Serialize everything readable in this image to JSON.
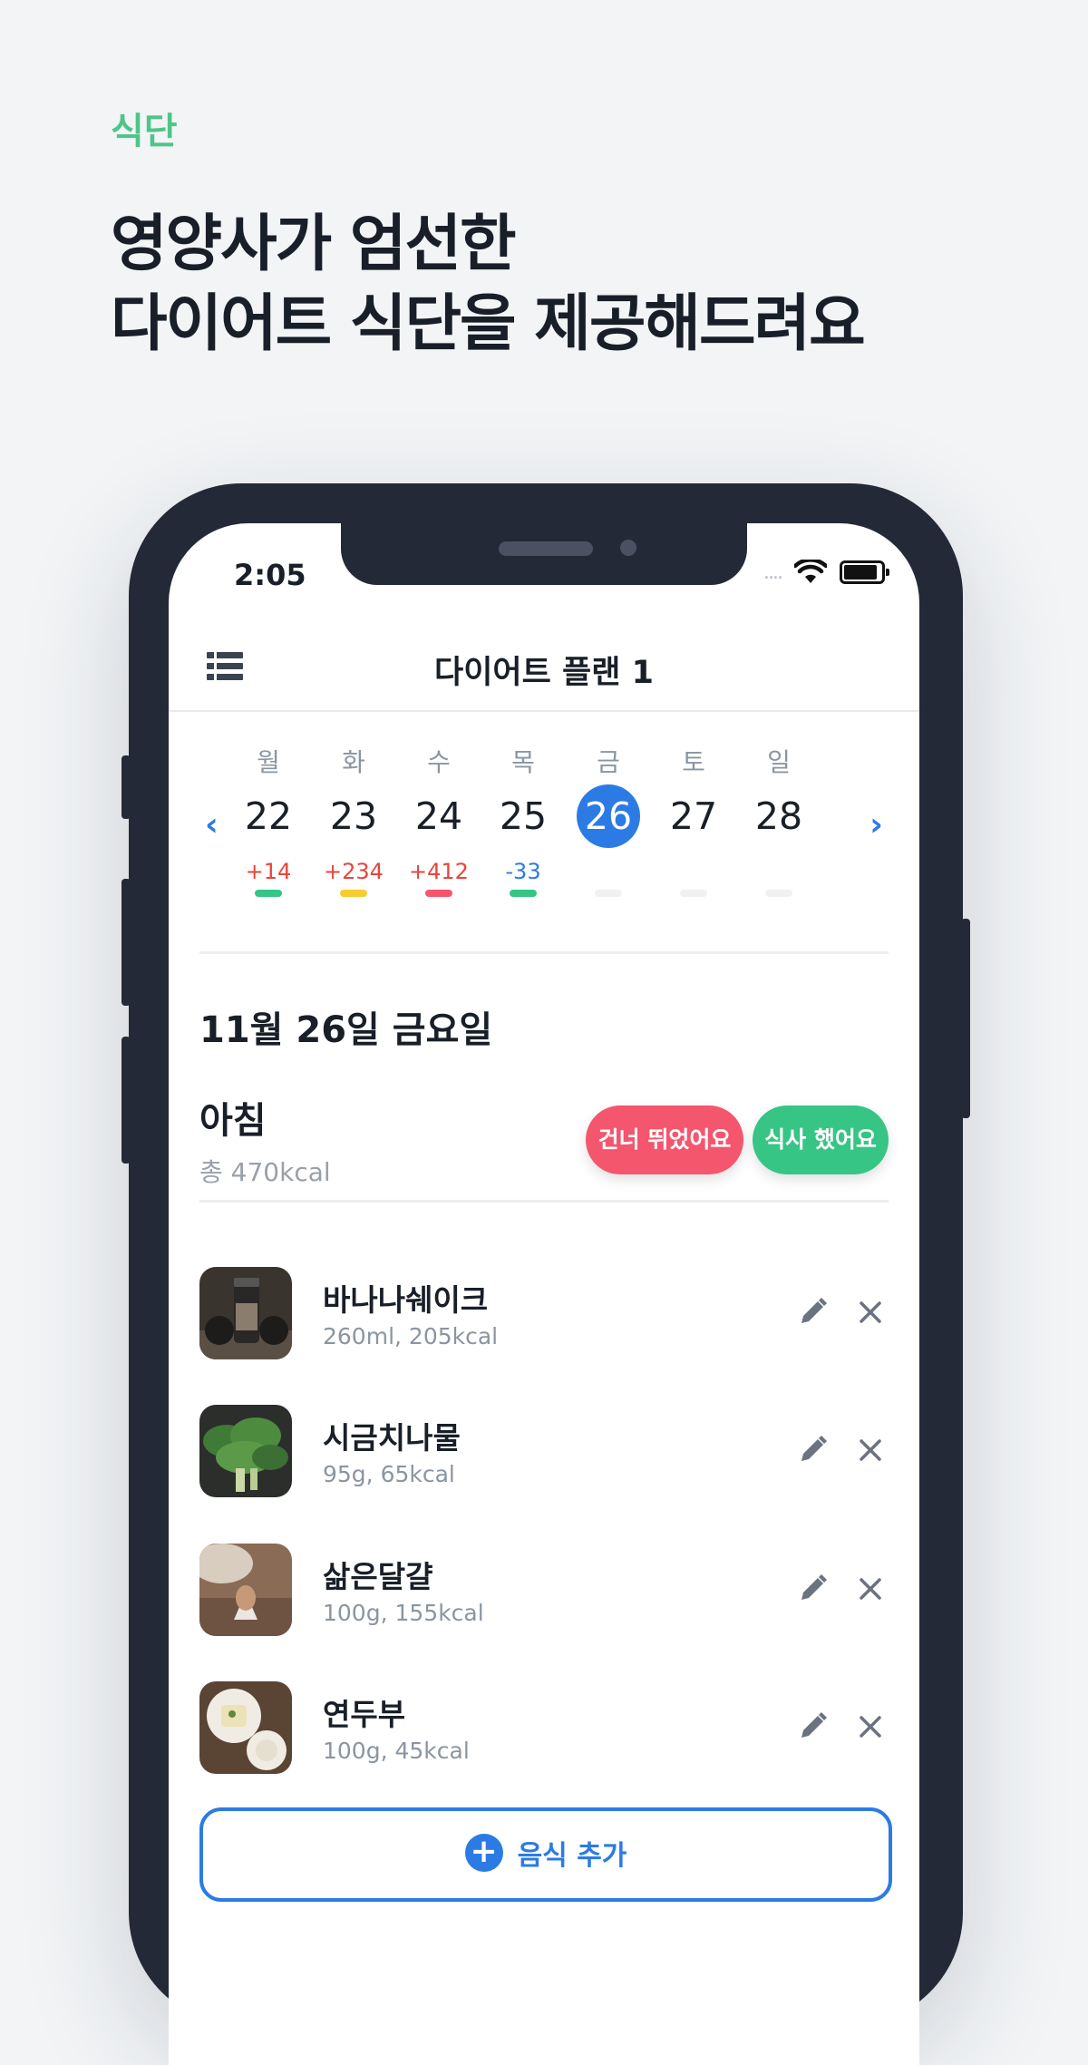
{
  "hero": {
    "category": "식단",
    "headline_line1": "영양사가 엄선한",
    "headline_line2": "다이어트 식단을 제공해드려요"
  },
  "status_bar": {
    "time": "2:05",
    "signal_dots": "....",
    "icons": [
      "wifi-icon",
      "battery-icon"
    ]
  },
  "header": {
    "title": "다이어트 플랜 1",
    "menu_icon": "list-icon"
  },
  "week": {
    "prev_icon": "chevron-left-icon",
    "next_icon": "chevron-right-icon",
    "days": [
      {
        "dow": "월",
        "num": "22",
        "delta": "+14",
        "delta_color": "#e8453c",
        "bar_color": "#36c585",
        "selected": false
      },
      {
        "dow": "화",
        "num": "23",
        "delta": "+234",
        "delta_color": "#e8453c",
        "bar_color": "#f6cc2f",
        "selected": false
      },
      {
        "dow": "수",
        "num": "24",
        "delta": "+412",
        "delta_color": "#e8453c",
        "bar_color": "#f4566e",
        "selected": false
      },
      {
        "dow": "목",
        "num": "25",
        "delta": "-33",
        "delta_color": "#2c7be5",
        "bar_color": "#36c585",
        "selected": false
      },
      {
        "dow": "금",
        "num": "26",
        "delta": "",
        "delta_color": "#191f28",
        "bar_color": "#f0f1f3",
        "selected": true
      },
      {
        "dow": "토",
        "num": "27",
        "delta": "",
        "delta_color": "#191f28",
        "bar_color": "#f0f1f3",
        "selected": false
      },
      {
        "dow": "일",
        "num": "28",
        "delta": "",
        "delta_color": "#191f28",
        "bar_color": "#f0f1f3",
        "selected": false
      }
    ]
  },
  "selected_date": "11월 26일 금요일",
  "meal": {
    "name": "아침",
    "total": "총 470kcal",
    "skip_label": "건너 뛰었어요",
    "ate_label": "식사 했어요"
  },
  "foods": [
    {
      "name": "바나나쉐이크",
      "meta": "260ml, 205kcal",
      "thumb": "shaker-bottle-photo"
    },
    {
      "name": "시금치나물",
      "meta": "95g, 65kcal",
      "thumb": "spinach-photo"
    },
    {
      "name": "삶은달걀",
      "meta": "100g, 155kcal",
      "thumb": "boiled-egg-photo"
    },
    {
      "name": "연두부",
      "meta": "100g, 45kcal",
      "thumb": "soft-tofu-photo"
    }
  ],
  "add_food": {
    "label": "음식 추가",
    "icon": "plus-circle-icon"
  },
  "colors": {
    "accent": "#2c7be5",
    "category": "#4fc489",
    "skip": "#f4566e",
    "ate": "#36c585",
    "frame": "#232937"
  }
}
